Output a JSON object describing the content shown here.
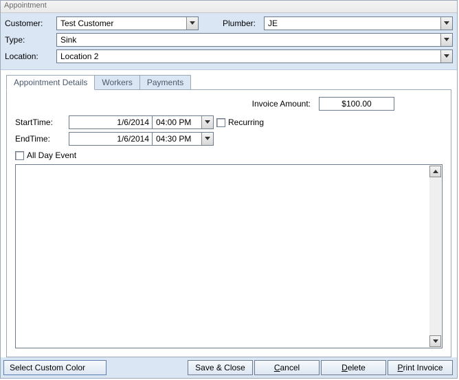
{
  "window": {
    "title": "Appointment"
  },
  "header": {
    "customer_label": "Customer:",
    "customer_value": "Test Customer",
    "plumber_label": "Plumber:",
    "plumber_value": "JE",
    "type_label": "Type:",
    "type_value": "Sink",
    "location_label": "Location:",
    "location_value": "Location 2"
  },
  "tabs": {
    "details": "Appointment Details",
    "workers": "Workers",
    "payments": "Payments"
  },
  "details": {
    "invoice_label": "Invoice Amount:",
    "invoice_value": "$100.00",
    "start_label": "StartTime:",
    "start_date": "1/6/2014",
    "start_time": "04:00 PM",
    "end_label": "EndTime:",
    "end_date": "1/6/2014",
    "end_time": "04:30 PM",
    "recurring_label": "Recurring",
    "allday_label": "All Day Event"
  },
  "footer": {
    "select_color": "Select Custom Color",
    "save_close": "Save & Close",
    "cancel": "Cancel",
    "delete": "Delete",
    "print": "Print Invoice"
  }
}
